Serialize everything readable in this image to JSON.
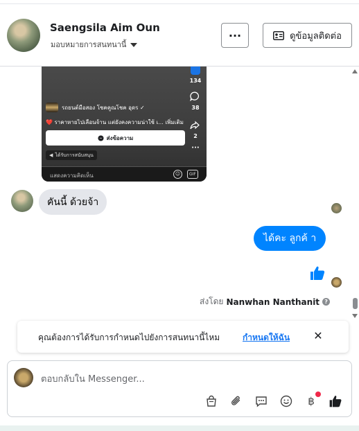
{
  "header": {
    "name": "Saengsila Aim Oun",
    "assign_label": "มอบหมายการสนทนานี้",
    "more_label": "···",
    "contact_label": "ดูข้อมูลติดต่อ"
  },
  "post": {
    "likes": "134",
    "comments": "38",
    "shares": "2",
    "more": "···",
    "author": "รถยนต์มือสอง โชคคูณโชค อุดร ✓",
    "description": "❤️ ราคาหายไปเลือนจ้าน แต่ยังคงความน่าใช้ เ... เพิ่มเติม",
    "message_button": "ส่งข้อความ",
    "sponsor_label": "ได้รับการสนับสนุน",
    "comment_placeholder": "แสดงความคิดเห็น",
    "gif": "GIF"
  },
  "messages": {
    "incoming": "คันนี้ ด้วยจ้า",
    "outgoing": "ได้คะ ลูกค้ า",
    "sent_by_prefix": "ส่งโดย",
    "sent_by_name": "Nanwhan Nanthanit"
  },
  "banner": {
    "text": "คุณต้องการได้รับการกำหนดไปยังการสนทนานี้ไหม",
    "link": "กำหนดให้ฉัน",
    "close": "✕"
  },
  "composer": {
    "placeholder": "ตอบกลับใน Messenger..."
  },
  "colors": {
    "accent": "#0084ff",
    "link": "#1877f2",
    "badge": "#f02849"
  }
}
